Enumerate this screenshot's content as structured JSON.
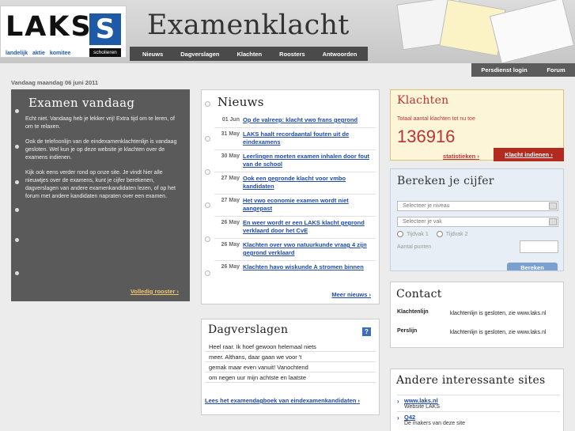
{
  "header": {
    "logo_text": "LAKS",
    "logo_letter": "S",
    "logo_tags": "landelijk aktie komitee",
    "logo_badge": "scholieren",
    "site_title": "Examenklacht",
    "nav": [
      "Nieuws",
      "Dagverslagen",
      "Klachten",
      "Roosters",
      "Antwoorden"
    ],
    "util_nav": [
      "Persdienst login",
      "Forum"
    ]
  },
  "date": "Vandaag maandag 06 juni 2011",
  "today": {
    "title": "Examen vandaag",
    "paragraphs": [
      "Echt niet. Vandaag heb je lekker vrij! Extra tijd om te leren, of om te relaxen.",
      "Ook de telefoonlijn van de eindexamenklachtenlijn is vandaag gesloten. Wel kun je op deze website je klachten over de examens indienen.",
      "Kijk ook eens verder rond op onze site. Je vindt hier alle nieuwtjes over de examens, kunt je cijfer berekenen, dagverslagen van andere examenkandidaten lezen, of op het forum met andere kandidaten napraten over een examen."
    ],
    "more": "Volledig rooster"
  },
  "news": {
    "title": "Nieuws",
    "items": [
      {
        "date": "01 Jun",
        "title": "Op de valreep: klacht vwo frans gegrond"
      },
      {
        "date": "31 May",
        "title": "LAKS haalt recordaantal fouten uit de eindexamens"
      },
      {
        "date": "30 May",
        "title": "Leerlingen moeten examen inhalen door fout van de school"
      },
      {
        "date": "27 May",
        "title": "Ook een gegronde klacht voor vmbo kandidaten"
      },
      {
        "date": "27 May",
        "title": "Het vwo economie examen wordt niet aangepast"
      },
      {
        "date": "26 May",
        "title": "En weer wordt er een LAKS klacht gegrond verklaard door het CvE"
      },
      {
        "date": "26 May",
        "title": "Klachten over vwo natuurkunde vraag 4 zijn gegrond verklaard"
      },
      {
        "date": "26 May",
        "title": "Klachten havo wiskunde A stromen binnen"
      }
    ],
    "more": "Meer nieuws"
  },
  "dagverslagen": {
    "title": "Dagverslagen",
    "help": "?",
    "lines": [
      "Heel raar. Ik hoef gewoon helemaal niets",
      "meer. Althans, daar gaan we voor 't",
      "gemak maar even vanuit! Vanochtend",
      "om negen uur mijn achtste en laatste"
    ],
    "link": "Lees het examendagboek van eindexamenkandidaten"
  },
  "klachten": {
    "title": "Klachten",
    "subtitle": "Totaal aantal klachten tot nu toe",
    "count": "136916",
    "stats": "statistieken",
    "button": "Klacht indienen"
  },
  "calc": {
    "title": "Bereken je cijfer",
    "level_placeholder": "Selecteer je niveau",
    "subject_placeholder": "Selecteer je vak",
    "period1": "Tijdvak 1",
    "period2": "Tijdvak 2",
    "points_label": "Aantal punten",
    "button": "Bereken"
  },
  "contact": {
    "title": "Contact",
    "rows": [
      {
        "key": "Klachtenlijn",
        "value": "klachtenlijn is gesloten, zie www.laks.nl"
      },
      {
        "key": "Perslijn",
        "value": "klachtenlijn is gesloten, zie www.laks.nl"
      }
    ]
  },
  "sites": {
    "title": "Andere interessante sites",
    "items": [
      {
        "name": "www.laks.nl",
        "desc": "Website LAKS"
      },
      {
        "name": "Q42",
        "desc": "De makers van deze site"
      }
    ]
  },
  "colors": {
    "brand_blue": "#1f5aa6",
    "accent_red": "#b22a1f",
    "link_blue": "#1f4aa6"
  }
}
